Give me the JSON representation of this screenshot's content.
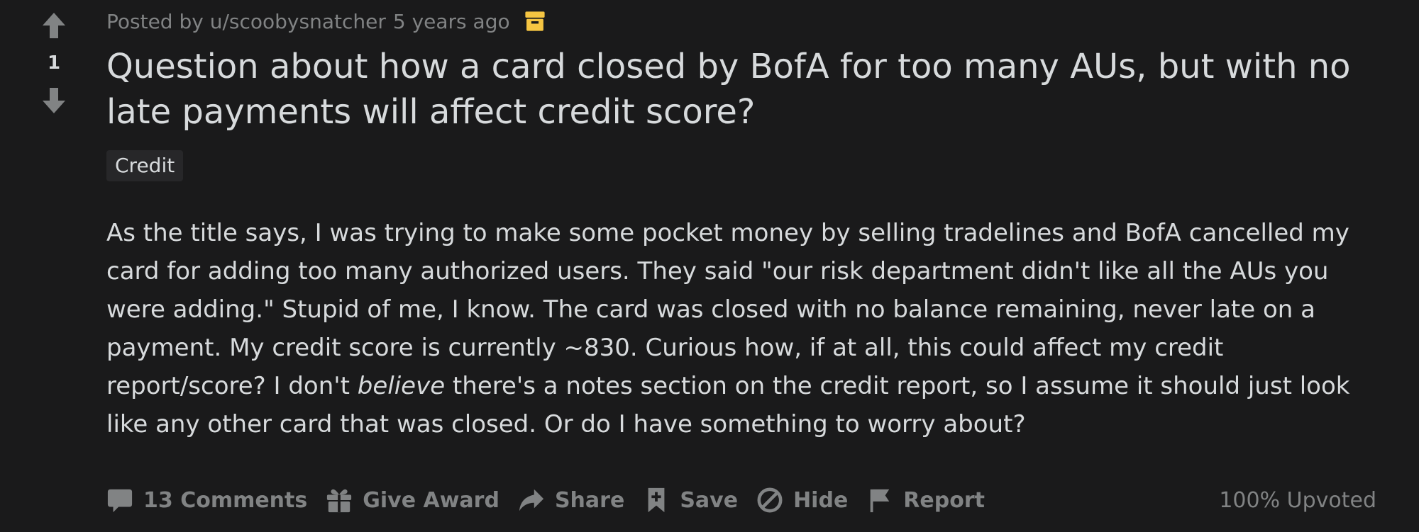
{
  "vote": {
    "count": "1"
  },
  "meta": {
    "posted_by": "Posted by u/scoobysnatcher",
    "age": "5 years ago",
    "archived_icon": "archive-box-icon",
    "archived_color": "#f5c542"
  },
  "post": {
    "title": "Question about how a card closed by BofA for too many AUs, but with no late payments will affect credit score?",
    "flair": "Credit",
    "body_before": "As the title says, I was trying to make some pocket money by selling tradelines and BofA cancelled my card for adding too many authorized users. They said \"our risk department didn't like all the AUs you were adding.\" Stupid of me, I know. The card was closed with no balance remaining, never late on a payment. My credit score is currently ~830. Curious how, if at all, this could affect my credit report/score? I don't ",
    "body_emphasis": "believe",
    "body_after": " there's a notes section on the credit report, so I assume it should just look like any other card that was closed. Or do I have something to worry about?"
  },
  "actions": {
    "comments": "13 Comments",
    "award": "Give Award",
    "share": "Share",
    "save": "Save",
    "hide": "Hide",
    "report": "Report",
    "upvoted": "100% Upvoted"
  },
  "colors": {
    "background": "#1a1a1b",
    "text": "#d7dadc",
    "muted": "#818384",
    "flair_bg": "#272729"
  }
}
